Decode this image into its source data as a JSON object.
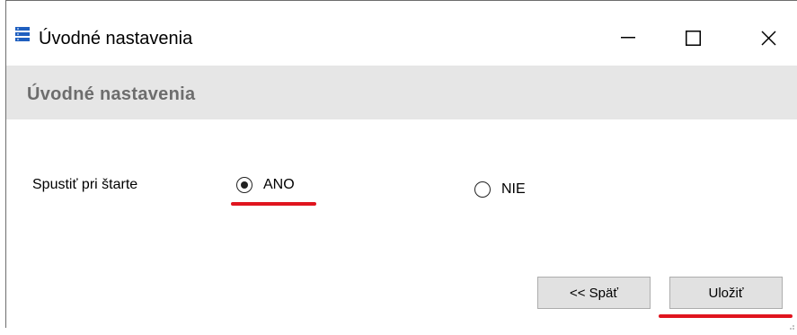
{
  "window": {
    "title": "Úvodné nastavenia",
    "controls": {
      "minimize": "minimize-icon",
      "maximize": "maximize-icon",
      "close": "close-icon"
    }
  },
  "header": {
    "title": "Úvodné nastavenia"
  },
  "form": {
    "startup_label": "Spustiť pri štarte",
    "options": [
      {
        "label": "ANO",
        "selected": true
      },
      {
        "label": "NIE",
        "selected": false
      }
    ]
  },
  "buttons": {
    "back": "<< Späť",
    "save": "Uložiť"
  },
  "colors": {
    "highlight_underline": "#e0141e",
    "header_background": "#e6e6e6",
    "header_text": "#6d6d6d",
    "button_background": "#e1e1e1",
    "app_icon": "#1f5fbf"
  }
}
